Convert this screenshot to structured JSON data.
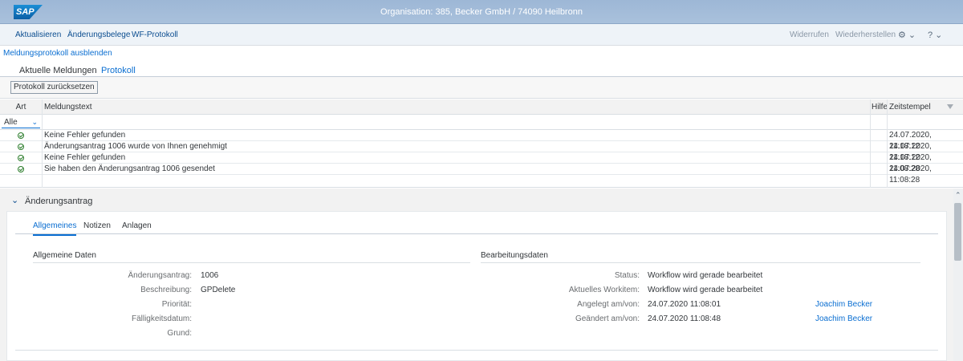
{
  "shell": {
    "logo_text": "SAP",
    "title": "Organisation: 385, Becker GmbH / 74090 Heilbronn"
  },
  "toolbar": {
    "refresh": "Aktualisieren",
    "change_docs": "Änderungsbelege",
    "wf_log": "WF-Protokoll",
    "undo": "Widerrufen",
    "redo": "Wiederherstellen"
  },
  "log": {
    "hide_link": "Meldungsprotokoll ausblenden",
    "tabs": [
      "Aktuelle Meldungen",
      "Protokoll"
    ],
    "active_tab": "Protokoll",
    "reset_button": "Protokoll zurücksetzen",
    "columns": {
      "art": "Art",
      "text": "Meldungstext",
      "help": "Hilfe",
      "timestamp": "Zeitstempel"
    },
    "filter_value": "Alle",
    "rows": [
      {
        "type": "success",
        "text": "Keine Fehler gefunden",
        "timestamp": "24.07.2020, 11:18:12"
      },
      {
        "type": "success",
        "text": "Änderungsantrag 1006 wurde von Ihnen genehmigt",
        "timestamp": "24.07.2020, 11:18:12"
      },
      {
        "type": "success",
        "text": "Keine Fehler gefunden",
        "timestamp": "24.07.2020, 11:08:28"
      },
      {
        "type": "success",
        "text": "Sie haben den Änderungsantrag 1006 gesendet",
        "timestamp": "24.07.2020, 11:08:28"
      }
    ]
  },
  "section": {
    "title": "Änderungsantrag",
    "tabs": [
      "Allgemeines",
      "Notizen",
      "Anlagen"
    ],
    "active_tab": "Allgemeines",
    "general": {
      "title": "Allgemeine Daten",
      "change_request_label": "Änderungsantrag:",
      "change_request_value": "1006",
      "description_label": "Beschreibung:",
      "description_value": "GPDelete",
      "priority_label": "Priorität:",
      "due_date_label": "Fälligkeitsdatum:",
      "reason_label": "Grund:"
    },
    "processing": {
      "title": "Bearbeitungsdaten",
      "status_label": "Status:",
      "status_value": "Workflow wird gerade bearbeitet",
      "workitem_label": "Aktuelles Workitem:",
      "workitem_value": "Workflow wird gerade bearbeitet",
      "created_label": "Angelegt am/von:",
      "created_value": "24.07.2020 11:08:01",
      "created_by": "Joachim Becker",
      "changed_label": "Geändert am/von:",
      "changed_value": "24.07.2020 11:08:48",
      "changed_by": "Joachim Becker"
    }
  },
  "colors": {
    "shell": "#a3bcd9",
    "link": "#0a6ed1",
    "success": "#2b7c2b"
  }
}
